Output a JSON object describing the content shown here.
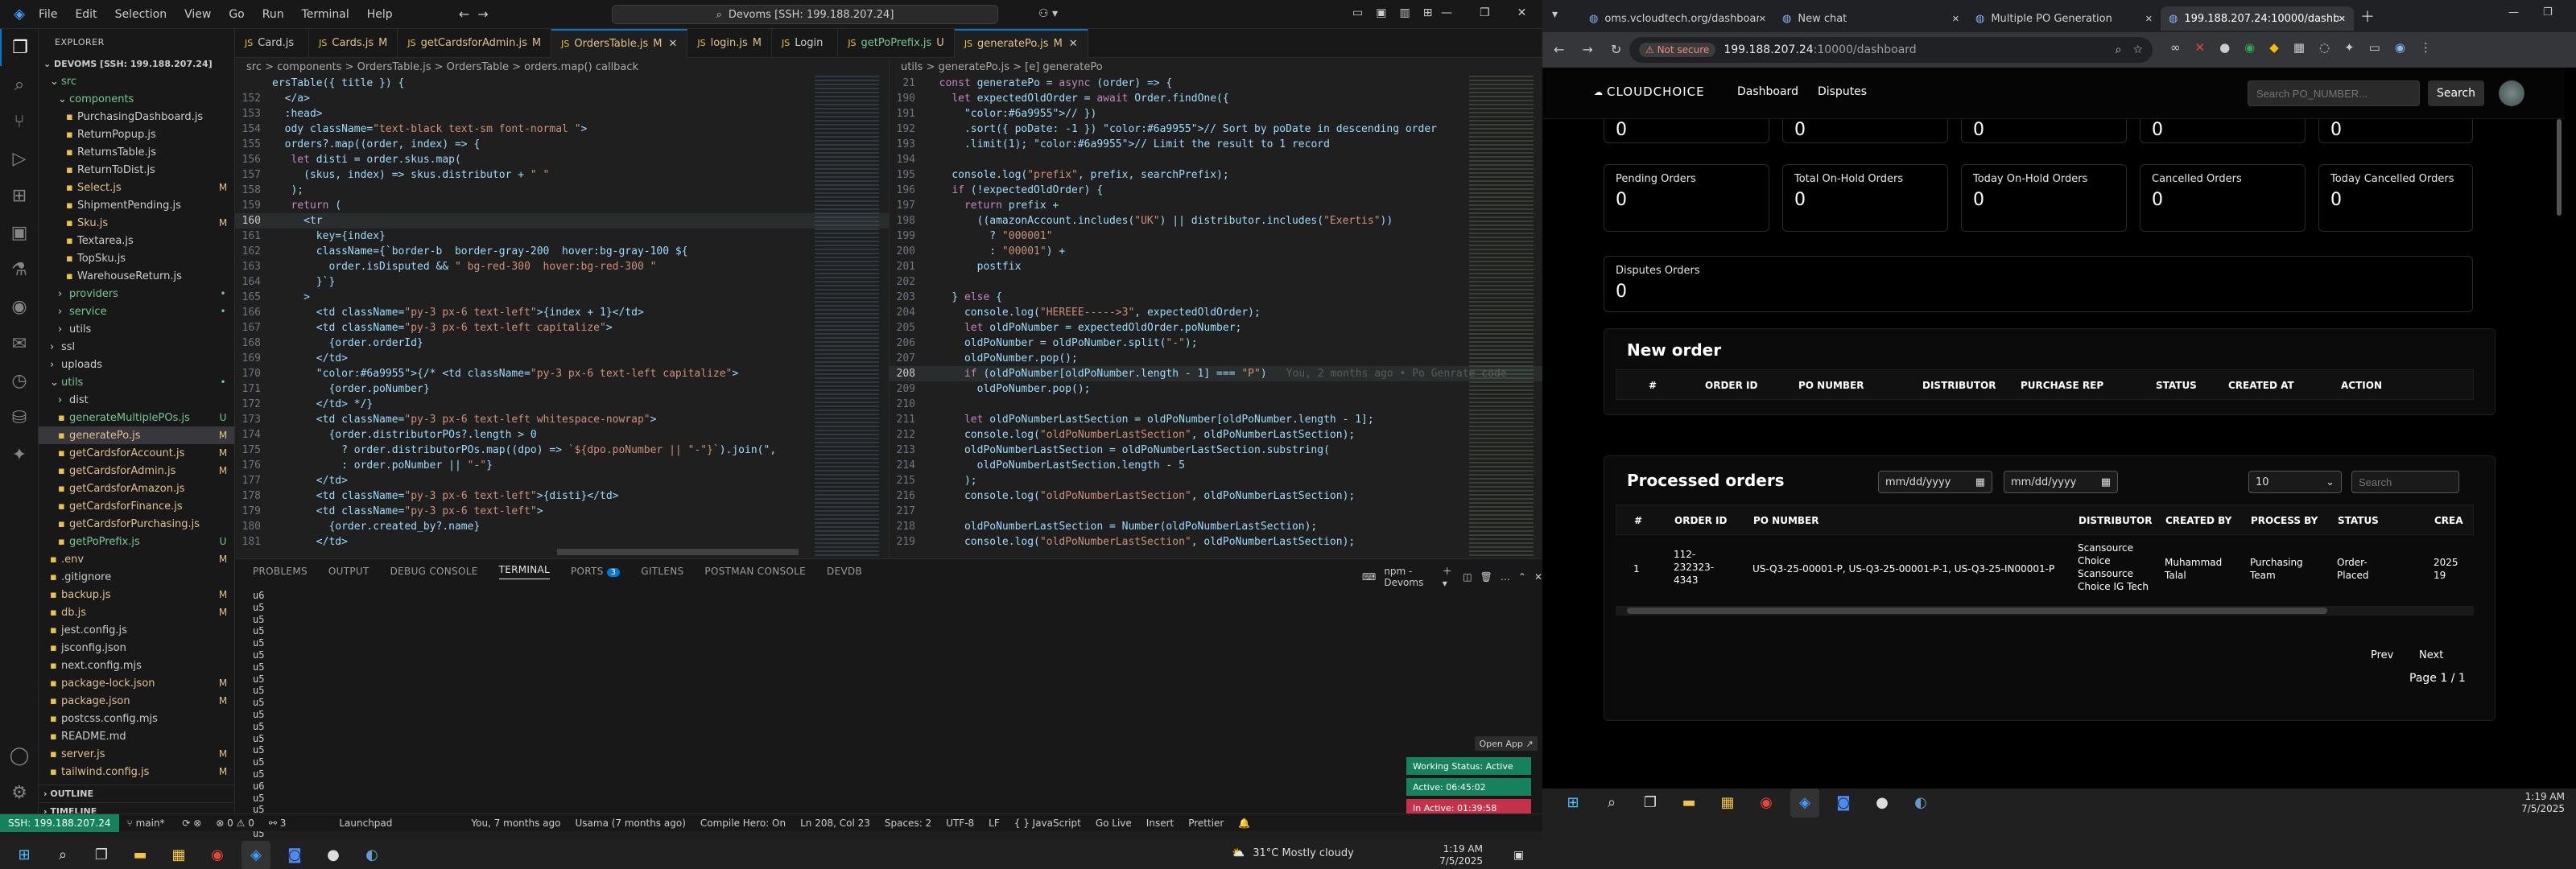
{
  "vscode": {
    "menu": [
      "File",
      "Edit",
      "Selection",
      "View",
      "Go",
      "Run",
      "Terminal",
      "Help"
    ],
    "command_center": "Devoms [SSH: 199.188.207.24]",
    "explorer_title": "EXPLORER",
    "workspace": "DEVOMS [SSH: 199.188.207.24]",
    "tree": [
      {
        "d": 1,
        "n": "src",
        "t": "folder",
        "o": true,
        "b": "",
        "c": "#73c991"
      },
      {
        "d": 2,
        "n": "components",
        "t": "folder",
        "o": true,
        "b": "",
        "c": "#73c991"
      },
      {
        "d": 3,
        "n": "PurchasingDashboard.js",
        "t": "file",
        "b": "",
        "c": "#ccc"
      },
      {
        "d": 3,
        "n": "ReturnPopup.js",
        "t": "file",
        "b": "",
        "c": "#ccc"
      },
      {
        "d": 3,
        "n": "ReturnsTable.js",
        "t": "file",
        "b": "",
        "c": "#ccc"
      },
      {
        "d": 3,
        "n": "ReturnToDist.js",
        "t": "file",
        "b": "",
        "c": "#ccc"
      },
      {
        "d": 3,
        "n": "Select.js",
        "t": "file",
        "b": "M",
        "c": "#e2c08d"
      },
      {
        "d": 3,
        "n": "ShipmentPending.js",
        "t": "file",
        "b": "",
        "c": "#ccc"
      },
      {
        "d": 3,
        "n": "Sku.js",
        "t": "file",
        "b": "M",
        "c": "#e2c08d"
      },
      {
        "d": 3,
        "n": "Textarea.js",
        "t": "file",
        "b": "",
        "c": "#ccc"
      },
      {
        "d": 3,
        "n": "TopSku.js",
        "t": "file",
        "b": "",
        "c": "#ccc"
      },
      {
        "d": 3,
        "n": "WarehouseReturn.js",
        "t": "file",
        "b": "",
        "c": "#ccc"
      },
      {
        "d": 2,
        "n": "providers",
        "t": "folder",
        "o": false,
        "b": "•",
        "c": "#73c991"
      },
      {
        "d": 2,
        "n": "service",
        "t": "folder",
        "o": false,
        "b": "•",
        "c": "#73c991"
      },
      {
        "d": 2,
        "n": "utils",
        "t": "folder",
        "o": false,
        "b": "",
        "c": "#ccc"
      },
      {
        "d": 1,
        "n": "ssl",
        "t": "folder",
        "o": false,
        "b": "",
        "c": "#ccc"
      },
      {
        "d": 1,
        "n": "uploads",
        "t": "folder",
        "o": false,
        "b": "",
        "c": "#ccc"
      },
      {
        "d": 1,
        "n": "utils",
        "t": "folder",
        "o": true,
        "b": "•",
        "c": "#73c991"
      },
      {
        "d": 2,
        "n": "dist",
        "t": "folder",
        "o": false,
        "b": "",
        "c": "#ccc"
      },
      {
        "d": 2,
        "n": "generateMultiplePOs.js",
        "t": "file",
        "b": "U",
        "c": "#73c991"
      },
      {
        "d": 2,
        "n": "generatePo.js",
        "t": "file",
        "b": "M",
        "c": "#e2c08d",
        "sel": true
      },
      {
        "d": 2,
        "n": "getCardsforAccount.js",
        "t": "file",
        "b": "M",
        "c": "#e2c08d"
      },
      {
        "d": 2,
        "n": "getCardsforAdmin.js",
        "t": "file",
        "b": "M",
        "c": "#e2c08d"
      },
      {
        "d": 2,
        "n": "getCardsforAmazon.js",
        "t": "file",
        "b": "",
        "c": "#e2c08d"
      },
      {
        "d": 2,
        "n": "getCardsforFinance.js",
        "t": "file",
        "b": "",
        "c": "#e2c08d"
      },
      {
        "d": 2,
        "n": "getCardsforPurchasing.js",
        "t": "file",
        "b": "",
        "c": "#e2c08d"
      },
      {
        "d": 2,
        "n": "getPoPrefix.js",
        "t": "file",
        "b": "U",
        "c": "#73c991"
      },
      {
        "d": 1,
        "n": ".env",
        "t": "file",
        "b": "M",
        "c": "#e2c08d"
      },
      {
        "d": 1,
        "n": ".gitignore",
        "t": "file",
        "b": "",
        "c": "#ccc"
      },
      {
        "d": 1,
        "n": "backup.js",
        "t": "file",
        "b": "M",
        "c": "#e2c08d"
      },
      {
        "d": 1,
        "n": "db.js",
        "t": "file",
        "b": "M",
        "c": "#e2c08d"
      },
      {
        "d": 1,
        "n": "jest.config.js",
        "t": "file",
        "b": "",
        "c": "#ccc"
      },
      {
        "d": 1,
        "n": "jsconfig.json",
        "t": "file",
        "b": "",
        "c": "#ccc"
      },
      {
        "d": 1,
        "n": "next.config.mjs",
        "t": "file",
        "b": "",
        "c": "#ccc"
      },
      {
        "d": 1,
        "n": "package-lock.json",
        "t": "file",
        "b": "M",
        "c": "#e2c08d"
      },
      {
        "d": 1,
        "n": "package.json",
        "t": "file",
        "b": "M",
        "c": "#e2c08d"
      },
      {
        "d": 1,
        "n": "postcss.config.mjs",
        "t": "file",
        "b": "",
        "c": "#ccc"
      },
      {
        "d": 1,
        "n": "README.md",
        "t": "file",
        "b": "",
        "c": "#ccc"
      },
      {
        "d": 1,
        "n": "server.js",
        "t": "file",
        "b": "M",
        "c": "#e2c08d"
      },
      {
        "d": 1,
        "n": "tailwind.config.js",
        "t": "file",
        "b": "M",
        "c": "#e2c08d"
      }
    ],
    "outline": "OUTLINE",
    "timeline": "TIMELINE",
    "tabs": [
      {
        "n": "Card.js",
        "active": false,
        "b": ""
      },
      {
        "n": "Cards.js",
        "active": false,
        "b": "M"
      },
      {
        "n": "getCardsforAdmin.js",
        "active": false,
        "b": "M"
      },
      {
        "n": "OrdersTable.js",
        "active": true,
        "b": "M"
      },
      {
        "n": "login.js",
        "active": false,
        "b": "M"
      },
      {
        "n": "Login",
        "active": false,
        "b": ""
      },
      {
        "n": "getPoPrefix.js",
        "active": false,
        "b": "U"
      },
      {
        "n": "generatePo.js",
        "active": true,
        "b": "M"
      }
    ],
    "left_crumb": "src > components > OrdersTable.js > OrdersTable > orders.map() callback",
    "right_crumb": "utils > generatePo.js > [e] generatePo",
    "left_code": [
      {
        "n": "",
        "t": "ersTable({ title }) {"
      },
      {
        "n": "152",
        "t": "  </a>"
      },
      {
        "n": "153",
        "t": "  :head>"
      },
      {
        "n": "154",
        "t": "  ody className=\"text-black text-sm font-normal \">"
      },
      {
        "n": "155",
        "t": "  orders?.map((order, index) => {"
      },
      {
        "n": "156",
        "t": "   let disti = order.skus.map("
      },
      {
        "n": "157",
        "t": "     (skus, index) => skus.distributor + \" \""
      },
      {
        "n": "158",
        "t": "   );"
      },
      {
        "n": "159",
        "t": "   return ("
      },
      {
        "n": "160",
        "t": "     <tr"
      },
      {
        "n": "161",
        "t": "       key={index}"
      },
      {
        "n": "162",
        "t": "       className={`border-b  border-gray-200  hover:bg-gray-100 ${"
      },
      {
        "n": "163",
        "t": "         order.isDisputed && \" bg-red-300  hover:bg-red-300 \""
      },
      {
        "n": "164",
        "t": "       }`}"
      },
      {
        "n": "165",
        "t": "     >"
      },
      {
        "n": "166",
        "t": "       <td className=\"py-3 px-6 text-left\">{index + 1}</td>"
      },
      {
        "n": "167",
        "t": "       <td className=\"py-3 px-6 text-left capitalize\">"
      },
      {
        "n": "168",
        "t": "         {order.orderId}"
      },
      {
        "n": "169",
        "t": "       </td>"
      },
      {
        "n": "170",
        "t": "       {/* <td className=\"py-3 px-6 text-left capitalize\">"
      },
      {
        "n": "171",
        "t": "         {order.poNumber}"
      },
      {
        "n": "172",
        "t": "       </td> */}"
      },
      {
        "n": "173",
        "t": "       <td className=\"py-3 px-6 text-left whitespace-nowrap\">"
      },
      {
        "n": "174",
        "t": "         {order.distributorPOs?.length > 0"
      },
      {
        "n": "175",
        "t": "           ? order.distributorPOs.map((dpo) => `${dpo.poNumber || \"-\"}`).join(\","
      },
      {
        "n": "176",
        "t": "           : order.poNumber || \"-\"}"
      },
      {
        "n": "177",
        "t": "       </td>"
      },
      {
        "n": "178",
        "t": "       <td className=\"py-3 px-6 text-left\">{disti}</td>"
      },
      {
        "n": "179",
        "t": "       <td className=\"py-3 px-6 text-left\">"
      },
      {
        "n": "180",
        "t": "         {order.created_by?.name}"
      },
      {
        "n": "181",
        "t": "       </td>"
      }
    ],
    "right_code": [
      {
        "n": "21",
        "t": "  const generatePo = async (order) => {"
      },
      {
        "n": "190",
        "t": "    let expectedOldOrder = await Order.findOne({"
      },
      {
        "n": "191",
        "t": "      // })"
      },
      {
        "n": "192",
        "t": "      .sort({ poDate: -1 }) // Sort by poDate in descending order"
      },
      {
        "n": "193",
        "t": "      .limit(1); // Limit the result to 1 record"
      },
      {
        "n": "194",
        "t": ""
      },
      {
        "n": "195",
        "t": "    console.log(\"prefix\", prefix, searchPrefix);"
      },
      {
        "n": "196",
        "t": "    if (!expectedOldOrder) {"
      },
      {
        "n": "197",
        "t": "      return prefix +"
      },
      {
        "n": "198",
        "t": "        ((amazonAccount.includes(\"UK\") || distributor.includes(\"Exertis\"))"
      },
      {
        "n": "199",
        "t": "          ? \"000001\""
      },
      {
        "n": "200",
        "t": "          : \"00001\") +"
      },
      {
        "n": "201",
        "t": "        postfix"
      },
      {
        "n": "202",
        "t": ""
      },
      {
        "n": "203",
        "t": "    } else {"
      },
      {
        "n": "204",
        "t": "      console.log(\"HEREEE----->3\", expectedOldOrder);"
      },
      {
        "n": "205",
        "t": "      let oldPoNumber = expectedOldOrder.poNumber;"
      },
      {
        "n": "206",
        "t": "      oldPoNumber = oldPoNumber.split(\"-\");"
      },
      {
        "n": "207",
        "t": "      oldPoNumber.pop();"
      },
      {
        "n": "208",
        "t": "      if (oldPoNumber[oldPoNumber.length - 1] === \"P\")"
      },
      {
        "n": "209",
        "t": "        oldPoNumber.pop();"
      },
      {
        "n": "210",
        "t": ""
      },
      {
        "n": "211",
        "t": "      let oldPoNumberLastSection = oldPoNumber[oldPoNumber.length - 1];"
      },
      {
        "n": "212",
        "t": "      console.log(\"oldPoNumberLastSection\", oldPoNumberLastSection);"
      },
      {
        "n": "213",
        "t": "      oldPoNumberLastSection = oldPoNumberLastSection.substring("
      },
      {
        "n": "214",
        "t": "        oldPoNumberLastSection.length - 5"
      },
      {
        "n": "215",
        "t": "      );"
      },
      {
        "n": "216",
        "t": "      console.log(\"oldPoNumberLastSection\", oldPoNumberLastSection);"
      },
      {
        "n": "217",
        "t": ""
      },
      {
        "n": "218",
        "t": "      oldPoNumberLastSection = Number(oldPoNumberLastSection);"
      },
      {
        "n": "219",
        "t": "      console.log(\"oldPoNumberLastSection\", oldPoNumberLastSection);"
      }
    ],
    "blame_ghost": "You, 2 months ago • Po Genrate code",
    "panel_tabs": [
      "PROBLEMS",
      "OUTPUT",
      "DEBUG CONSOLE",
      "TERMINAL",
      "PORTS",
      "GITLENS",
      "POSTMAN CONSOLE",
      "DEVDB"
    ],
    "ports_count": "3",
    "terminal_name": "npm - Devoms",
    "terminal_lines": [
      "u6",
      "u5",
      "u5",
      "u5",
      "u5",
      "u5",
      "u5",
      "u5",
      "u5",
      "u5",
      "u5",
      "u5",
      "u5",
      "u5",
      "u5",
      "u5",
      "u6",
      "u5",
      "u5",
      "u6",
      "u5",
      "u5",
      "u5",
      "u5",
      "u5",
      "u5",
      "u6"
    ],
    "open_app": "Open App ↗",
    "working_status": "Working Status: Active",
    "active_time": "Active: 06:45:02",
    "inactive_time": "In Active: 01:39:58",
    "status": {
      "ssh": "SSH: 199.188.207.24",
      "branch": "main*",
      "problems": "⊗ 0 ⚠ 0",
      "ports": "3",
      "launchpad": "Launchpad",
      "blame": "You, 7 months ago",
      "author": "Usama (7 months ago)",
      "compile": "Compile Hero: On",
      "position": "Ln 208, Col 23",
      "spaces": "Spaces: 2",
      "encoding": "UTF-8",
      "eol": "LF",
      "lang": "{ } JavaScript",
      "golive": "Go Live",
      "insert": "Insert",
      "prettier": "Prettier"
    }
  },
  "taskbar_left": {
    "weather": "31°C  Mostly cloudy",
    "time": "1:19 AM",
    "date": "7/5/2025"
  },
  "browser": {
    "tabs": [
      {
        "t": "oms.vcloudtech.org/dashboard",
        "active": false
      },
      {
        "t": "New chat",
        "active": false
      },
      {
        "t": "Multiple PO Generation",
        "active": false
      },
      {
        "t": "199.188.207.24:10000/dashboard",
        "active": true
      }
    ],
    "not_secure": "Not secure",
    "url_host": "199.188.207.24",
    "url_path": ":10000/dashboard",
    "app": {
      "logo": "CLOUDCHOICE",
      "nav": [
        "Dashboard",
        "Disputes"
      ],
      "search_placeholder": "Search PO_NUMBER...",
      "search_btn": "Search",
      "top_values": [
        "0",
        "0",
        "0",
        "0",
        "0"
      ],
      "cards_row1": [
        {
          "label": "Pending Orders",
          "value": "0"
        },
        {
          "label": "Total On-Hold Orders",
          "value": "0"
        },
        {
          "label": "Today On-Hold Orders",
          "value": "0"
        },
        {
          "label": "Cancelled Orders",
          "value": "0"
        },
        {
          "label": "Today Cancelled Orders",
          "value": "0"
        }
      ],
      "card_disputes": {
        "label": "Disputes Orders",
        "value": "0"
      },
      "new_order": {
        "title": "New order",
        "headers": [
          "#",
          "ORDER ID",
          "PO NUMBER",
          "DISTRIBUTOR",
          "PURCHASE REP",
          "STATUS",
          "CREATED AT",
          "ACTION"
        ]
      },
      "processed": {
        "title": "Processed orders",
        "date1": "mm/dd/yyyy",
        "date2": "mm/dd/yyyy",
        "page_size": "10",
        "search_placeholder": "Search",
        "headers": [
          "#",
          "ORDER ID",
          "PO NUMBER",
          "DISTRIBUTOR",
          "CREATED BY",
          "PROCESS BY",
          "STATUS",
          "CREA"
        ],
        "row": {
          "idx": "1",
          "order_id": "112-232323-4343",
          "po": "US-Q3-25-00001-P, US-Q3-25-00001-P-1, US-Q3-25-IN00001-P",
          "dist": "Scansource Choice Scansource Choice IG Tech",
          "created_by": "Muhammad Talal",
          "process_by": "Purchasing Team",
          "status": "Order-Placed",
          "created": "2025 19"
        },
        "prev": "Prev",
        "next": "Next",
        "page": "Page 1 / 1"
      }
    }
  },
  "taskbar_right": {
    "time": "1:19 AM",
    "date": "7/5/2025"
  }
}
